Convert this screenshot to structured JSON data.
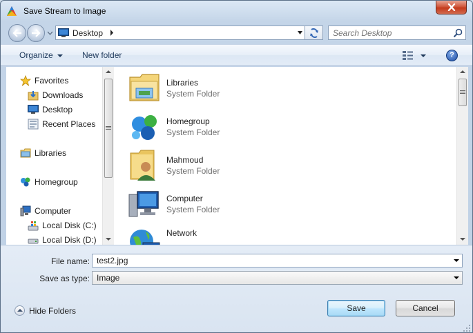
{
  "window": {
    "title": "Save Stream to Image"
  },
  "address": {
    "location": "Desktop"
  },
  "search": {
    "placeholder": "Search Desktop"
  },
  "toolbar": {
    "organize_label": "Organize",
    "new_folder_label": "New folder",
    "help_label": "?"
  },
  "navpane": {
    "favorites": "Favorites",
    "downloads": "Downloads",
    "desktop": "Desktop",
    "recent_places": "Recent Places",
    "libraries": "Libraries",
    "homegroup": "Homegroup",
    "computer": "Computer",
    "local_c": "Local Disk (C:)",
    "local_d": "Local Disk (D:)"
  },
  "files": [
    {
      "name": "Libraries",
      "type": "System Folder",
      "icon": "libraries-icon"
    },
    {
      "name": "Homegroup",
      "type": "System Folder",
      "icon": "homegroup-icon"
    },
    {
      "name": "Mahmoud",
      "type": "System Folder",
      "icon": "user-folder-icon"
    },
    {
      "name": "Computer",
      "type": "System Folder",
      "icon": "computer-icon"
    },
    {
      "name": "Network",
      "type": "",
      "icon": "network-icon"
    }
  ],
  "form": {
    "file_name_label": "File name:",
    "file_name_value": "test2.jpg",
    "save_type_label": "Save as type:",
    "save_type_value": "Image"
  },
  "footer": {
    "hide_folders_label": "Hide Folders",
    "save_label": "Save",
    "cancel_label": "Cancel"
  }
}
